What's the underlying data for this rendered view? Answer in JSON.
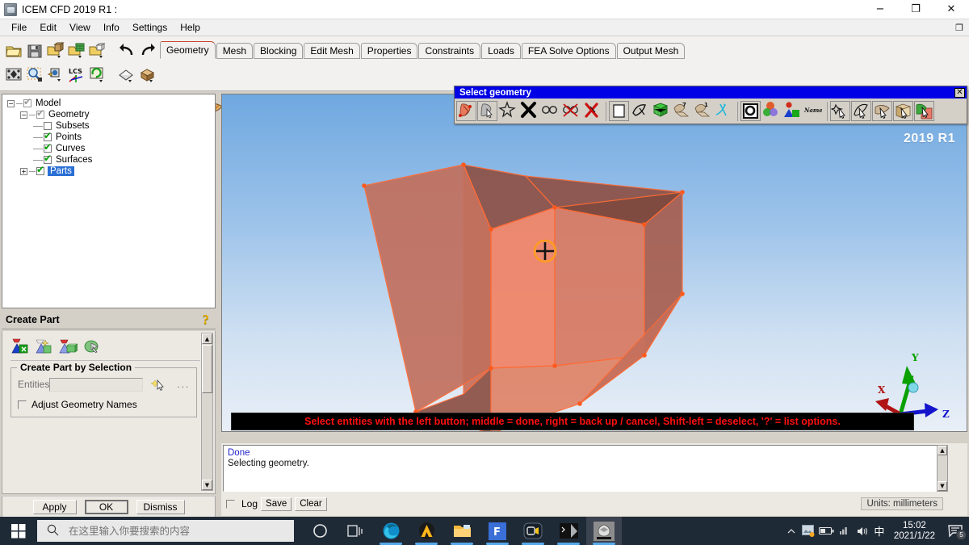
{
  "window": {
    "title": "ICEM CFD 2019 R1 :",
    "app_icon": "icem-cfd-icon",
    "minimize": "−",
    "maximize": "❐",
    "close": "✕",
    "restore_small": "❐"
  },
  "menu": {
    "items": [
      {
        "label": "File"
      },
      {
        "label": "Edit"
      },
      {
        "label": "View"
      },
      {
        "label": "Info"
      },
      {
        "label": "Settings"
      },
      {
        "label": "Help"
      }
    ]
  },
  "toolbar": {
    "file_icons": [
      {
        "name": "open-project-icon"
      },
      {
        "name": "save-project-icon"
      },
      {
        "name": "open-geometry-icon"
      },
      {
        "name": "open-mesh-icon"
      },
      {
        "name": "open-blocking-icon"
      }
    ],
    "history_icons": [
      {
        "name": "undo-icon"
      },
      {
        "name": "redo-icon"
      }
    ],
    "view_icons": [
      {
        "name": "fit-window-icon"
      },
      {
        "name": "zoom-box-icon"
      },
      {
        "name": "view-direction-icon"
      },
      {
        "name": "lcs-axes-icon"
      },
      {
        "name": "refresh-view-icon"
      }
    ],
    "display_icons": [
      {
        "name": "clip-plane-icon"
      },
      {
        "name": "solid-display-icon"
      }
    ]
  },
  "tabs": {
    "items": [
      {
        "label": "Geometry",
        "active": true
      },
      {
        "label": "Mesh",
        "active": false
      },
      {
        "label": "Blocking",
        "active": false
      },
      {
        "label": "Edit Mesh",
        "active": false
      },
      {
        "label": "Properties",
        "active": false
      },
      {
        "label": "Constraints",
        "active": false
      },
      {
        "label": "Loads",
        "active": false
      },
      {
        "label": "FEA Solve Options",
        "active": false
      },
      {
        "label": "Output Mesh",
        "active": false
      }
    ]
  },
  "geometry_functions": [
    {
      "name": "create-point-icon"
    },
    {
      "name": "create-curve-icon"
    },
    {
      "name": "create-surface-icon"
    },
    {
      "name": "create-body-icon"
    },
    {
      "name": "repair-geometry-icon"
    },
    {
      "name": "create-part-icon"
    },
    {
      "name": "transform-geometry-icon"
    },
    {
      "name": "restore-dormant-icon"
    },
    {
      "name": "delete-point-icon"
    },
    {
      "name": "delete-curve-icon"
    },
    {
      "name": "delete-surface-icon"
    },
    {
      "name": "delete-body-icon"
    },
    {
      "name": "delete-any-icon"
    }
  ],
  "tree": {
    "nodes": [
      {
        "label": "Model",
        "depth": 0,
        "expander": "−",
        "check": "gray",
        "selected": false
      },
      {
        "label": "Geometry",
        "depth": 1,
        "expander": "−",
        "check": "gray",
        "selected": false
      },
      {
        "label": "Subsets",
        "depth": 2,
        "expander": "",
        "check": "empty",
        "selected": false
      },
      {
        "label": "Points",
        "depth": 2,
        "expander": "",
        "check": "checked",
        "selected": false
      },
      {
        "label": "Curves",
        "depth": 2,
        "expander": "",
        "check": "checked",
        "selected": false
      },
      {
        "label": "Surfaces",
        "depth": 2,
        "expander": "",
        "check": "checked",
        "selected": false
      },
      {
        "label": "Parts",
        "depth": 1,
        "expander": "+",
        "check": "checked",
        "selected": true
      }
    ]
  },
  "create_part": {
    "title": "Create Part",
    "help_glyph": "?",
    "method_icons": [
      {
        "name": "create-part-icon"
      },
      {
        "name": "create-part-by-points-icon"
      },
      {
        "name": "create-assembly-icon"
      },
      {
        "name": "add-to-part-icon"
      }
    ],
    "group_title": "Create Part by Selection",
    "entities_label": "Entities",
    "entities_value": "",
    "select_icon": "select-entities-cursor-icon",
    "dots_label": "...",
    "adjust_names_label": "Adjust Geometry Names",
    "adjust_names_checked": false,
    "buttons": {
      "apply": "Apply",
      "ok": "OK",
      "dismiss": "Dismiss"
    },
    "scroll_up": "▲",
    "scroll_down": "▼"
  },
  "viewport": {
    "watermark": "2019 R1",
    "axes": {
      "x": "X",
      "y": "Y",
      "z": "Z"
    },
    "axis_colors": {
      "x": "#b01414",
      "y": "#0aa000",
      "z": "#1414cc"
    },
    "model_color": "#e8795c",
    "selection_marker": "selection-crosshair",
    "message": "Select entities with the left button; middle = done, right = back up / cancel, Shift-left = deselect, '?' = list options.",
    "message_color": "#ff1010"
  },
  "select_geometry_dialog": {
    "title": "Select geometry",
    "close_label": "✕",
    "icons": [
      {
        "name": "select-all-appropriate-icon"
      },
      {
        "name": "select-items-in-part-icon"
      },
      {
        "name": "select-items-in-subset-icon"
      },
      {
        "name": "cancel-selection-icon"
      },
      {
        "name": "toggle-selection-mode-icon"
      },
      {
        "name": "toggle-dynamic-icon"
      },
      {
        "name": "deselect-all-icon"
      },
      {
        "name": "select-by-box-icon"
      },
      {
        "name": "select-by-polygon-icon"
      },
      {
        "name": "select-surfaces-icon"
      },
      {
        "name": "select-curves-icon"
      },
      {
        "name": "select-points-icon"
      },
      {
        "name": "select-bodies-icon"
      },
      {
        "name": "select-by-loop-icon"
      },
      {
        "name": "select-by-color-icon"
      },
      {
        "name": "select-by-part-icon"
      },
      {
        "name": "select-by-name-icon"
      },
      {
        "name": "select-point-toggle-icon"
      },
      {
        "name": "select-curve-toggle-icon"
      },
      {
        "name": "select-surface-toggle-icon"
      },
      {
        "name": "select-body-toggle-icon"
      },
      {
        "name": "select-material-toggle-icon"
      }
    ],
    "name_icon_label": "Name"
  },
  "log": {
    "lines": [
      {
        "text": "Done",
        "color": "#2222cc"
      },
      {
        "text": "Selecting geometry.",
        "color": "#111111"
      }
    ],
    "log_checkbox_label": "Log",
    "log_checked": false,
    "save_label": "Save",
    "clear_label": "Clear",
    "units_label": "Units: millimeters",
    "scroll_up": "▲",
    "scroll_down": "▼"
  },
  "taskbar": {
    "start_icon": "windows-start-icon",
    "search_placeholder": "在这里输入你要搜索的内容",
    "search_value": "",
    "search_icon": "search-icon",
    "apps": [
      {
        "name": "cortana-icon",
        "running": false
      },
      {
        "name": "task-view-icon",
        "running": false
      },
      {
        "name": "microsoft-edge-icon",
        "running": true
      },
      {
        "name": "ansys-workbench-icon",
        "running": true
      },
      {
        "name": "file-explorer-icon",
        "running": true
      },
      {
        "name": "fluent-meshing-icon",
        "running": true
      },
      {
        "name": "camera-recorder-icon",
        "running": true
      },
      {
        "name": "command-prompt-icon",
        "running": true
      },
      {
        "name": "icem-cfd-icon",
        "running": true,
        "active": true
      }
    ],
    "tray": [
      {
        "name": "show-hidden-icons-chevron-icon",
        "glyph": "⌃"
      },
      {
        "name": "screenshot-tool-icon",
        "glyph": "▣"
      },
      {
        "name": "battery-icon",
        "glyph": "▭"
      },
      {
        "name": "wifi-icon",
        "glyph": "◢"
      },
      {
        "name": "volume-icon",
        "glyph": "◀)"
      },
      {
        "name": "ime-chinese-icon",
        "glyph": "中"
      }
    ],
    "clock": {
      "time": "15:02",
      "date": "2021/1/22"
    },
    "notification": {
      "name": "action-center-icon",
      "count": "5"
    }
  }
}
